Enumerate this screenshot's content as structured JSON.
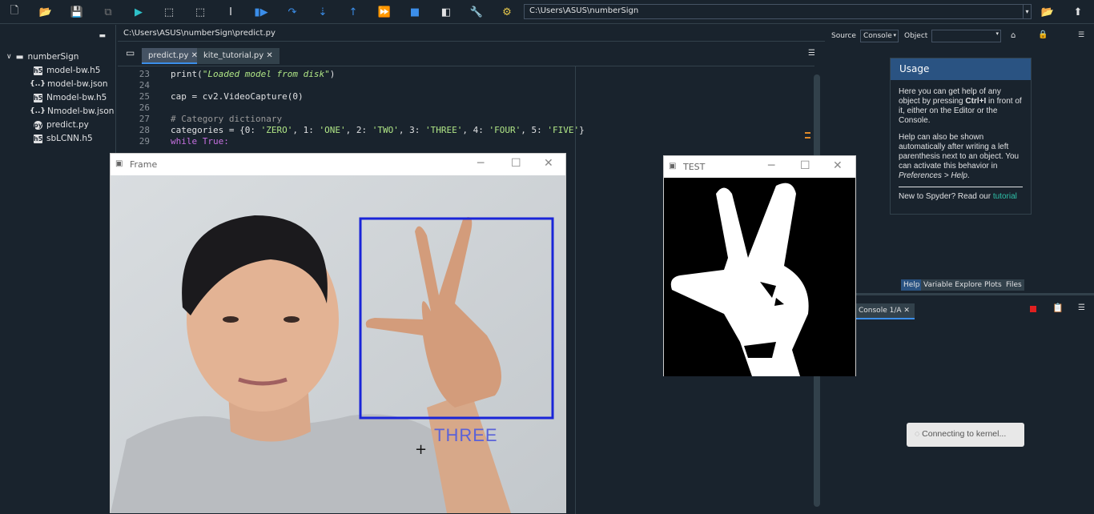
{
  "toolbar": {
    "path": "C:\\Users\\ASUS\\numberSign"
  },
  "project": {
    "root": "numberSign",
    "files": [
      {
        "name": "model-bw.h5",
        "type": "h5"
      },
      {
        "name": "model-bw.json",
        "type": "json"
      },
      {
        "name": "Nmodel-bw.h5",
        "type": "h5"
      },
      {
        "name": "Nmodel-bw.json",
        "type": "json"
      },
      {
        "name": "predict.py",
        "type": "py"
      },
      {
        "name": "sbLCNN.h5",
        "type": "h5"
      }
    ]
  },
  "editor": {
    "path": "C:\\Users\\ASUS\\numberSign\\predict.py",
    "tabs": [
      "predict.py",
      "kite_tutorial.py"
    ],
    "lines": {
      "n23": "23",
      "n24": "24",
      "n25": "25",
      "n26": "26",
      "n27": "27",
      "n28": "28",
      "n29": "29",
      "l23_a": "print(",
      "l23_b": "\"Loaded model from disk\"",
      "l23_c": ")",
      "l25": "cap = cv2.VideoCapture(0)",
      "l27": "# Category dictionary",
      "l28_a": "categories = {0: ",
      "l28_s0": "'ZERO'",
      "l28_s1": "'ONE'",
      "l28_s2": "'TWO'",
      "l28_s3": "'THREE'",
      "l28_s4": "'FOUR'",
      "l28_s5": "'FIVE'",
      "l29": "while True:"
    }
  },
  "help": {
    "source_label": "Source",
    "source_value": "Console",
    "object_label": "Object",
    "usage_title": "Usage",
    "p1_a": "Here you can get help of any object by pressing ",
    "p1_b": "Ctrl+I",
    "p1_c": " in front of it, either on the Editor or the Console.",
    "p2_a": "Help can also be shown automatically after writing a left parenthesis next to an object. You can activate this behavior in ",
    "p2_b": "Preferences > Help",
    "p2_c": ".",
    "p3_a": "New to Spyder? Read our ",
    "p3_b": "tutorial",
    "tabs": [
      "Help",
      "Variable Explorer",
      "Plots",
      "Files"
    ]
  },
  "console": {
    "tab": "Console 1/A",
    "status": "Connecting to kernel..."
  },
  "frame_window": {
    "title": "Frame",
    "prediction": "THREE"
  },
  "test_window": {
    "title": "TEST"
  }
}
